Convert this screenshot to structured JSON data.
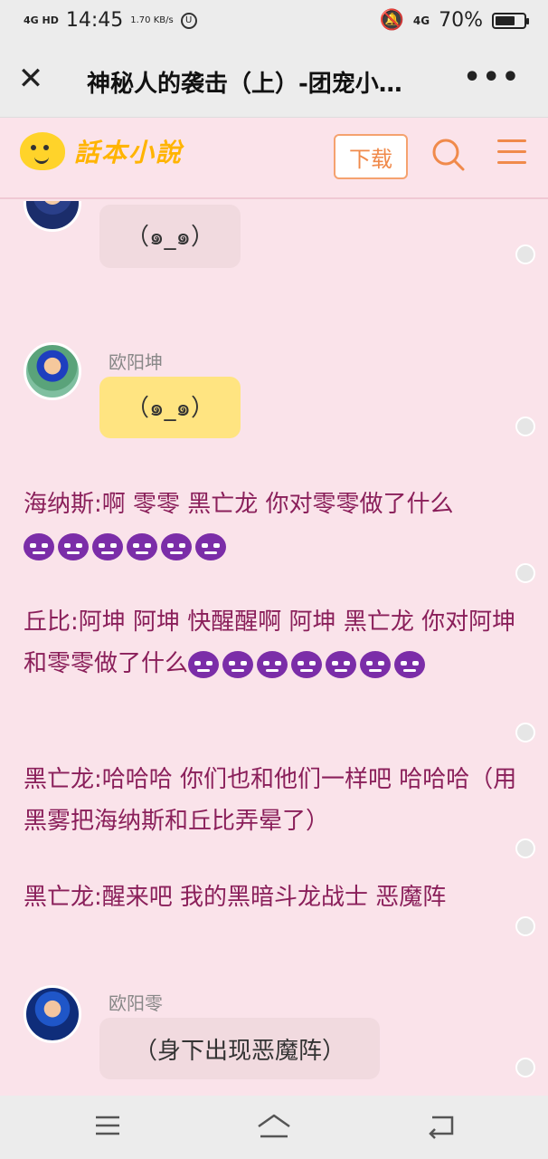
{
  "status": {
    "network": "4G HD",
    "time": "14:45",
    "speed": "1.70 KB/s",
    "signal_right": "4G",
    "battery": "70%",
    "battery_level": 0.7
  },
  "titlebar": {
    "title": "神秘人的袭击（上）-团宠小…",
    "close_icon": "close-icon",
    "more_label": "•••"
  },
  "site": {
    "brand": "話本小說",
    "download_label": "下载"
  },
  "messages": [
    {
      "name": "",
      "text": "（๑_๑）"
    },
    {
      "name": "欧阳坤",
      "text": "（๑_๑）"
    },
    {
      "name": "欧阳零",
      "text": "（身下出现恶魔阵）"
    }
  ],
  "paragraphs": [
    {
      "text": "海纳斯:啊 零零 黑亡龙 你对零零做了什么",
      "emoji_count": 6
    },
    {
      "text": "丘比:阿坤 阿坤 快醒醒啊 阿坤 黑亡龙 你对阿坤和零零做了什么",
      "emoji_count": 7
    },
    {
      "text": "黑亡龙:哈哈哈 你们也和他们一样吧 哈哈哈（用黑雾把海纳斯和丘比弄晕了）",
      "emoji_count": 0
    },
    {
      "text": "黑亡龙:醒来吧 我的黑暗斗龙战士 恶魔阵",
      "emoji_count": 0
    }
  ],
  "colors": {
    "page_bg": "#fae3ea",
    "accent": "#f08a4b",
    "story_text": "#8a1f5a"
  }
}
